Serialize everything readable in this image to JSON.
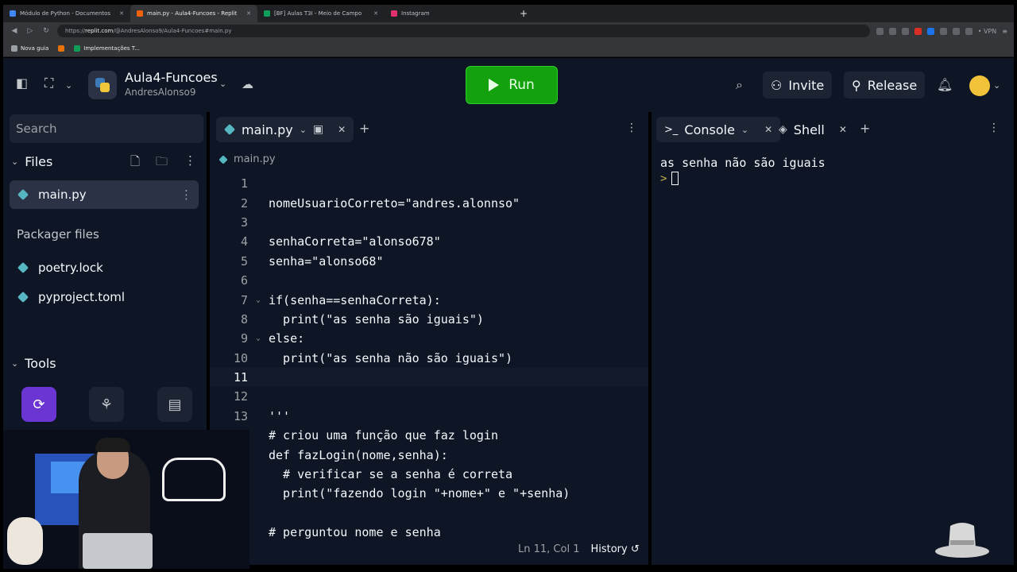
{
  "browser": {
    "tabs": [
      {
        "label": "Módulo de Python - Documentos",
        "color": "#4285f4"
      },
      {
        "label": "main.py - Aula4-Funcoes - Replit",
        "color": "#f26207"
      },
      {
        "label": "[BF] Aulas T3I - Meio de Campo",
        "color": "#0f9d58"
      },
      {
        "label": "Instagram",
        "color": "#e1306c"
      }
    ],
    "url_prefix": "https://",
    "url_host": "replit.com",
    "url_path": "/@AndresAlonso9/Aula4-Funcoes#main.py",
    "vpn_label": "• VPN",
    "bookmarks": [
      {
        "label": "Nova guia",
        "color": "#9aa0a6"
      },
      {
        "label": "",
        "color": "#e8710a"
      },
      {
        "label": "Implementações T...",
        "color": "#0f9d58"
      }
    ]
  },
  "header": {
    "repl_name": "Aula4-Funcoes",
    "owner": "AndresAlonso9",
    "run_label": "Run",
    "invite_label": "Invite",
    "release_label": "Release"
  },
  "sidebar": {
    "search_placeholder": "Search",
    "files_title": "Files",
    "files": [
      "main.py"
    ],
    "packager_title": "Packager files",
    "packager_files": [
      "poetry.lock",
      "pyproject.toml"
    ],
    "tools_title": "Tools"
  },
  "editor": {
    "tab_label": "main.py",
    "breadcrumb": "main.py",
    "lines": [
      {
        "n": "1",
        "text": ""
      },
      {
        "n": "2",
        "text": "nomeUsuarioCorreto=\"andres.alonnso\""
      },
      {
        "n": "3",
        "text": ""
      },
      {
        "n": "4",
        "text": "senhaCorreta=\"alonso678\""
      },
      {
        "n": "5",
        "text": "senha=\"alonso68\""
      },
      {
        "n": "6",
        "text": ""
      },
      {
        "n": "7",
        "text": "if(senha==senhaCorreta):",
        "fold": true
      },
      {
        "n": "8",
        "text": "  print(\"as senha são iguais\")"
      },
      {
        "n": "9",
        "text": "else:",
        "fold": true
      },
      {
        "n": "10",
        "text": "  print(\"as senha não são iguais\")"
      },
      {
        "n": "11",
        "text": "",
        "current": true
      },
      {
        "n": "12",
        "text": ""
      },
      {
        "n": "13",
        "text": "'''"
      },
      {
        "n": "",
        "text": "# criou uma função que faz login"
      },
      {
        "n": "",
        "text": "def fazLogin(nome,senha):"
      },
      {
        "n": "",
        "text": "  # verificar se a senha é correta"
      },
      {
        "n": "",
        "text": "  print(\"fazendo login \"+nome+\" e \"+senha)"
      },
      {
        "n": "",
        "text": ""
      },
      {
        "n": "",
        "text": "# perguntou nome e senha"
      }
    ],
    "cursor_position": "Ln 11, Col 1",
    "history_label": "History"
  },
  "console": {
    "console_tab": "Console",
    "shell_tab": "Shell",
    "output": "as senha não são iguais",
    "prompt": ">"
  }
}
